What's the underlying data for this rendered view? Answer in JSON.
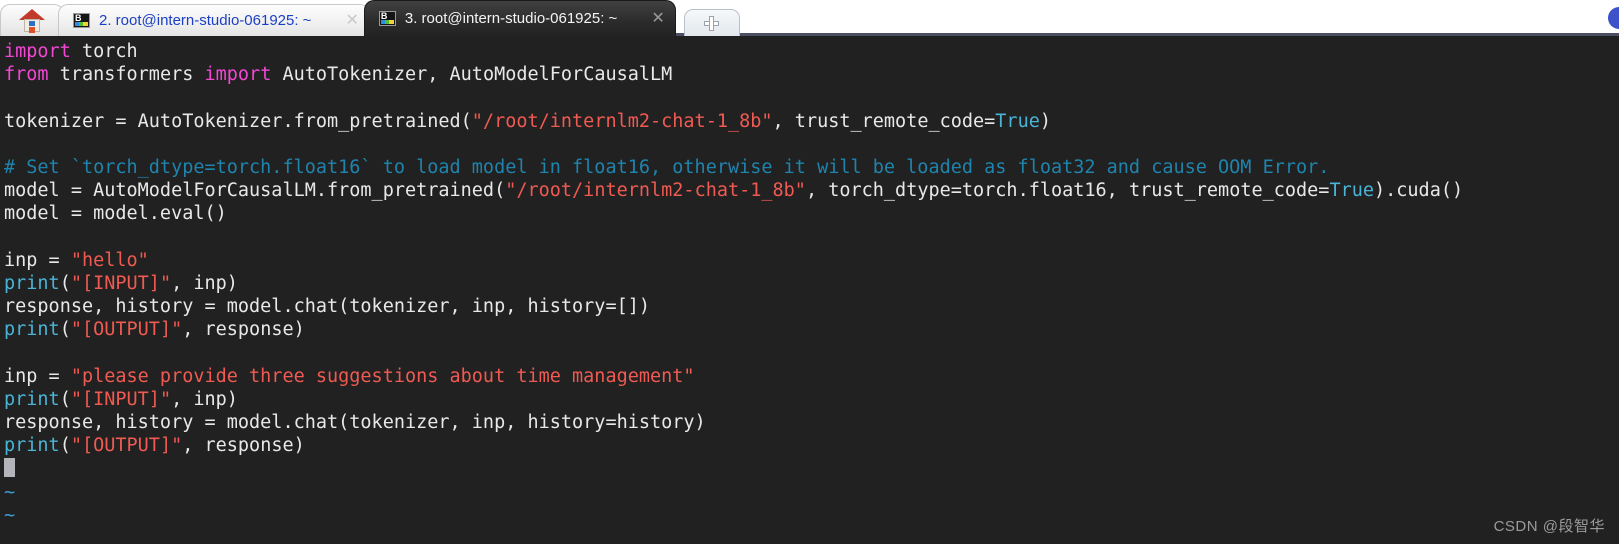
{
  "tabbar": {
    "home_tab": {
      "name": "home-tab",
      "icon": "home-icon",
      "label": ""
    },
    "tabs": [
      {
        "label": "2. root@intern-studio-061925: ~",
        "active": false,
        "icon": "terminal-icon",
        "close": "✕"
      },
      {
        "label": "3. root@intern-studio-061925: ~",
        "active": true,
        "icon": "terminal-icon",
        "close": "✕"
      }
    ],
    "new_tab_label": "+",
    "colors": {
      "active_tab_bg": "#2b2b2b",
      "inactive_tab_text": "#1a3fc4",
      "underline": "#4a4f63"
    }
  },
  "terminal": {
    "background": "#212121",
    "foreground": "#e8e8e8",
    "cursor_color": "#b4b4bb",
    "syntax_colors": {
      "keyword": "#f246d3",
      "string": "#f05a52",
      "builtin": "#49b4d6",
      "comment": "#1f84ad",
      "tilde": "#3c9fd8"
    },
    "lines": {
      "l1_import": "import",
      "l1_torch": " torch",
      "l2_from": "from",
      "l2_transformers": " transformers ",
      "l2_import": "import",
      "l2_rest": " AutoTokenizer, AutoModelForCausalLM",
      "l4_a": "tokenizer = AutoTokenizer.from_pretrained(",
      "l4_str": "\"/root/internlm2-chat-1_8b\"",
      "l4_b": ", trust_remote_code=",
      "l4_true": "True",
      "l4_c": ")",
      "l6_comment": "# Set `torch_dtype=torch.float16` to load model in float16, otherwise it will be loaded as float32 and cause OOM Error.",
      "l7_a": "model = AutoModelForCausalLM.from_pretrained(",
      "l7_str": "\"/root/internlm2-chat-1_8b\"",
      "l7_b": ", torch_dtype=torch.float16, trust_remote_code=",
      "l7_true": "True",
      "l7_c": ").cuda()",
      "l8": "model = model.eval()",
      "l10_a": "inp = ",
      "l10_str": "\"hello\"",
      "l11_print": "print",
      "l11_a": "(",
      "l11_str": "\"[INPUT]\"",
      "l11_b": ", inp)",
      "l12": "response, history = model.chat(tokenizer, inp, history=[])",
      "l13_print": "print",
      "l13_a": "(",
      "l13_str": "\"[OUTPUT]\"",
      "l13_b": ", response)",
      "l15_a": "inp = ",
      "l15_str": "\"please provide three suggestions about time management\"",
      "l16_print": "print",
      "l16_a": "(",
      "l16_str": "\"[INPUT]\"",
      "l16_b": ", inp)",
      "l17": "response, history = model.chat(tokenizer, inp, history=history)",
      "l18_print": "print",
      "l18_a": "(",
      "l18_str": "\"[OUTPUT]\"",
      "l18_b": ", response)",
      "l20_tilde": "~",
      "l21_tilde": "~"
    }
  },
  "watermark": "CSDN @段智华"
}
